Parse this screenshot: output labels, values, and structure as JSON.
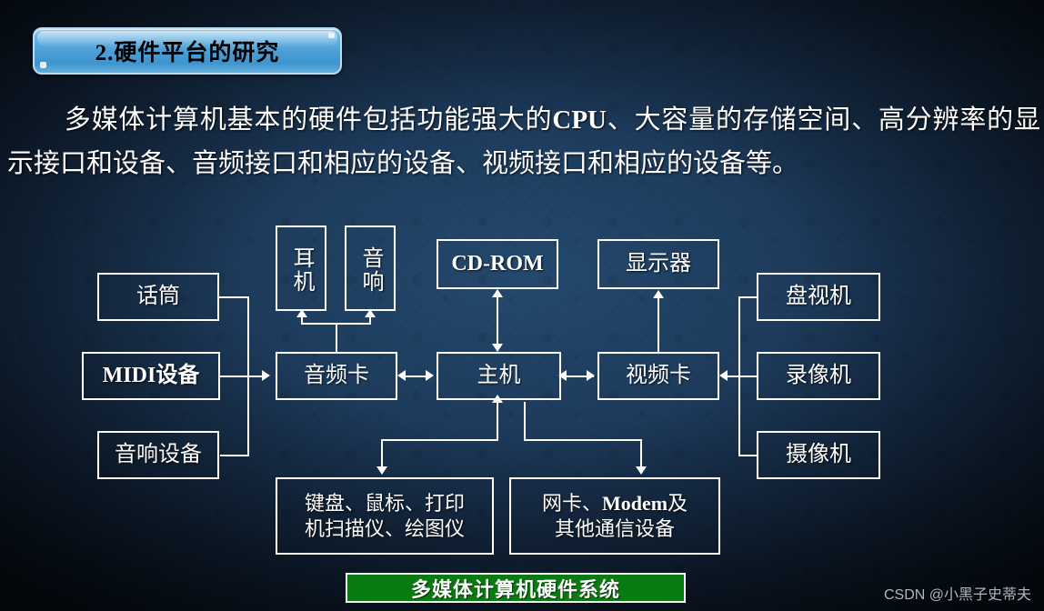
{
  "slide": {
    "title": "2.硬件平台的研究",
    "body_indent": "　　",
    "body_text": "多媒体计算机基本的硬件包括功能强大的CPU、大容量的存储空间、高分辨率的显示接口和设备、音频接口和相应的设备、视频接口和相应的设备等。",
    "body_line1": "多媒体计算机基本的硬件包括功能强大的",
    "body_line1_bold": "CPU",
    "body_line1_tail": "、大容量的存储空间、高分辨率",
    "body_line2": "的显示接口和设备、音频接口和相应的设备、视频接口和相应的设备等。"
  },
  "diagram": {
    "caption": "多媒体计算机硬件系统",
    "nodes": {
      "microphone": "话筒",
      "midi_device": "MIDI设备",
      "audio_device": "音响设备",
      "headphone": "耳机",
      "speaker": "音响",
      "audio_card": "音频卡",
      "cdrom": "CD-ROM",
      "host": "主机",
      "monitor": "显示器",
      "video_card": "视频卡",
      "disc_player": "盘视机",
      "vcr": "录像机",
      "camera": "摄像机",
      "input_devices": "键盘、鼠标、打印机扫描仪、绘图仪",
      "input_devices_l1": "键盘、鼠标、打印",
      "input_devices_l2": "机扫描仪、绘图仪",
      "network_devices": "网卡、Modem及其他通信设备",
      "network_devices_l1a": "网卡、",
      "network_devices_l1b": "Modem",
      "network_devices_l1c": "及",
      "network_devices_l2": "其他通信设备"
    }
  },
  "watermark": "CSDN @小黑子史蒂夫",
  "colors": {
    "background_center": "#24496e",
    "background_edge": "#07111c",
    "banner_blue": "#4b9fd6",
    "caption_green": "#0a7a12",
    "line_white": "#ffffff"
  }
}
